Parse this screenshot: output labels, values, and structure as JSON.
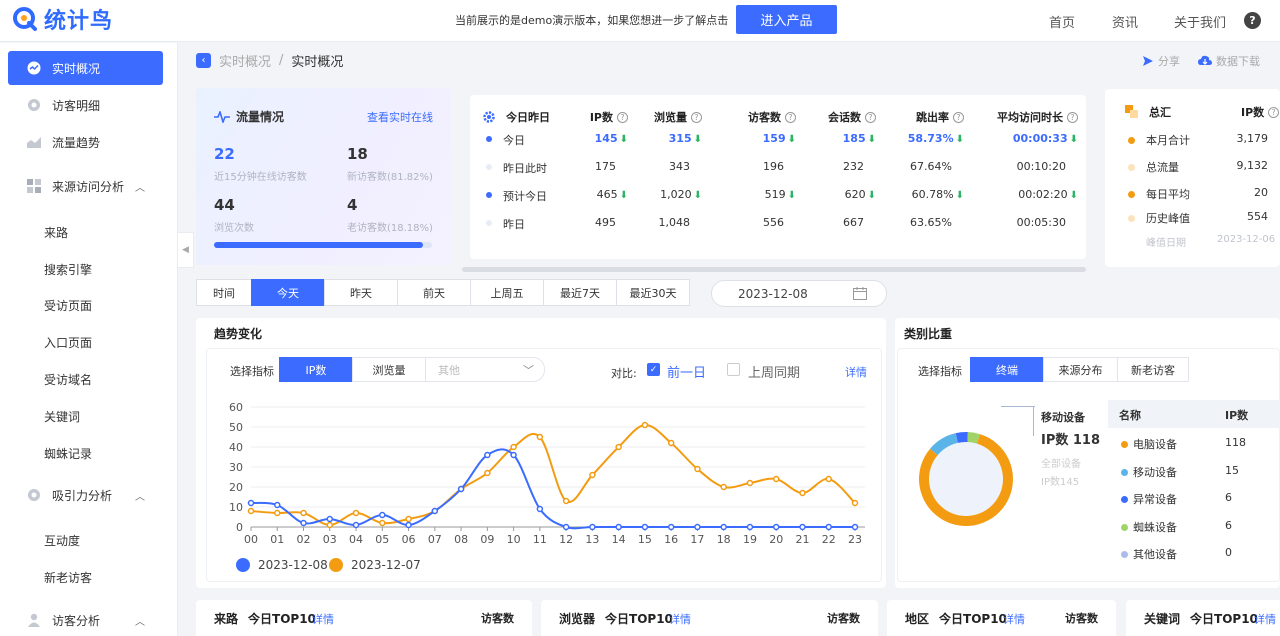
{
  "app": {
    "logo_text": "统计鸟",
    "brand_color": "#3b6cff"
  },
  "topbar": {
    "demo_notice": "当前展示的是demo演示版本，如果您想进一步了解点击",
    "enter_button": "进入产品",
    "nav": [
      "首页",
      "资讯",
      "关于我们"
    ],
    "help": "?"
  },
  "sidebar": {
    "items": [
      {
        "label": "实时概况",
        "icon": "realtime-icon",
        "active": true
      },
      {
        "label": "访客明细",
        "icon": "visitor-detail-icon"
      },
      {
        "label": "流量趋势",
        "icon": "trend-icon"
      },
      {
        "label": "来源访问分析",
        "icon": "source-icon",
        "expanded": true
      },
      {
        "label": "吸引力分析",
        "icon": "attraction-icon",
        "expanded": true
      },
      {
        "label": "访客分析",
        "icon": "user-icon",
        "expanded": true
      }
    ],
    "source_sub": [
      "来路",
      "搜索引擎",
      "受访页面",
      "入口页面",
      "受访域名",
      "关键词",
      "蜘蛛记录"
    ],
    "attraction_sub": [
      "互动度",
      "新老访客"
    ]
  },
  "breadcrumb": {
    "parent": "实时概况",
    "sep": "/",
    "current": "实时概况"
  },
  "actions": {
    "share": "分享",
    "download": "数据下载"
  },
  "flow": {
    "title": "流量情况",
    "link": "查看实时在线",
    "online": "22",
    "online_label": "近15分钟在线访客数",
    "new_visitors": "18",
    "new_label": "新访客数(81.82%)",
    "pv": "44",
    "pv_label": "浏览次数",
    "old_visitors": "4",
    "old_label": "老访客数(18.18%)",
    "progress": 0.96
  },
  "today_table": {
    "title": "今日昨日",
    "headers": [
      "IP数",
      "浏览量",
      "访客数",
      "会话数",
      "跳出率",
      "平均访问时长"
    ],
    "rows": [
      {
        "label": "今日",
        "dot": "#3b6cff",
        "values": [
          "145",
          "315",
          "159",
          "185",
          "58.73%",
          "00:00:33"
        ],
        "arrows": [
          true,
          true,
          true,
          true,
          true,
          true
        ],
        "highlight": true
      },
      {
        "label": "昨日此时",
        "dot": "#e8ecf6",
        "values": [
          "175",
          "343",
          "196",
          "232",
          "67.64%",
          "00:10:20"
        ],
        "arrows": [
          false,
          false,
          false,
          false,
          false,
          false
        ]
      },
      {
        "label": "预计今日",
        "dot": "#3b6cff",
        "values": [
          "465",
          "1,020",
          "519",
          "620",
          "60.78%",
          "00:02:20"
        ],
        "arrows": [
          true,
          true,
          true,
          true,
          true,
          true
        ]
      },
      {
        "label": "昨日",
        "dot": "#e8ecf6",
        "values": [
          "495",
          "1,048",
          "556",
          "667",
          "63.65%",
          "00:05:30"
        ],
        "arrows": [
          false,
          false,
          false,
          false,
          false,
          false
        ]
      }
    ],
    "down_arrow": "⬇"
  },
  "summary": {
    "title": "总汇",
    "header": "IP数",
    "rows": [
      {
        "label": "本月合计",
        "value": "3,179",
        "dot": "#f39c12"
      },
      {
        "label": "总流量",
        "value": "9,132",
        "dot": "#fde3bd"
      },
      {
        "label": "每日平均",
        "value": "20",
        "dot": "#f39c12"
      },
      {
        "label": "历史峰值",
        "value": "554",
        "dot": "#fde3bd"
      }
    ],
    "peak_label": "峰值日期",
    "peak_date": "2023-12-06"
  },
  "date_tabs": {
    "label": "时间",
    "tabs": [
      "今天",
      "昨天",
      "前天",
      "上周五",
      "最近7天",
      "最近30天"
    ],
    "active": 0,
    "date": "2023-12-08"
  },
  "trend": {
    "title": "趋势变化",
    "select_label": "选择指标",
    "metrics": [
      "IP数",
      "浏览量"
    ],
    "other_placeholder": "其他",
    "compare_label": "对比:",
    "compare_prev": "前一日",
    "compare_week": "上周同期",
    "detail": "详情"
  },
  "chart_data": {
    "type": "line",
    "x": [
      "00",
      "01",
      "02",
      "03",
      "04",
      "05",
      "06",
      "07",
      "08",
      "09",
      "10",
      "11",
      "12",
      "13",
      "14",
      "15",
      "16",
      "17",
      "18",
      "19",
      "20",
      "21",
      "22",
      "23"
    ],
    "ylim": [
      0,
      60
    ],
    "yticks": [
      0,
      10,
      20,
      30,
      40,
      50,
      60
    ],
    "series": [
      {
        "name": "2023-12-08",
        "color": "#3b6cff",
        "values": [
          12,
          11,
          2,
          4,
          1,
          6,
          1,
          8,
          19,
          36,
          36,
          9,
          0,
          0,
          0,
          0,
          0,
          0,
          0,
          0,
          0,
          0,
          0,
          0
        ]
      },
      {
        "name": "2023-12-07",
        "color": "#f39c12",
        "values": [
          8,
          7,
          7,
          1,
          7,
          2,
          4,
          8,
          19,
          27,
          40,
          45,
          13,
          26,
          40,
          51,
          42,
          29,
          20,
          22,
          24,
          17,
          24,
          12
        ]
      }
    ]
  },
  "category": {
    "title": "类别比重",
    "select_label": "选择指标",
    "tabs": [
      "终端",
      "来源分布",
      "新老访客"
    ],
    "callout_title": "移动设备",
    "callout_value": "IP数 118",
    "callout_sub1": "全部设备",
    "callout_sub2": "IP数145",
    "table_headers": [
      "名称",
      "IP数"
    ],
    "rows": [
      {
        "label": "电脑设备",
        "value": "118",
        "color": "#f39c12"
      },
      {
        "label": "移动设备",
        "value": "15",
        "color": "#5ab4e8"
      },
      {
        "label": "异常设备",
        "value": "6",
        "color": "#3b6cff"
      },
      {
        "label": "蜘蛛设备",
        "value": "6",
        "color": "#a0d468"
      },
      {
        "label": "其他设备",
        "value": "0",
        "color": "#a9bde8"
      }
    ]
  },
  "bottom_cards": [
    {
      "title": "来路",
      "sub": "今日TOP10",
      "link": "详情",
      "col": "访客数"
    },
    {
      "title": "浏览器",
      "sub": "今日TOP10",
      "link": "详情",
      "col": "访客数"
    },
    {
      "title": "地区",
      "sub": "今日TOP10",
      "link": "详情",
      "col": "访客数"
    },
    {
      "title": "关键词",
      "sub": "今日TOP10",
      "link": "详情",
      "col": ""
    }
  ]
}
